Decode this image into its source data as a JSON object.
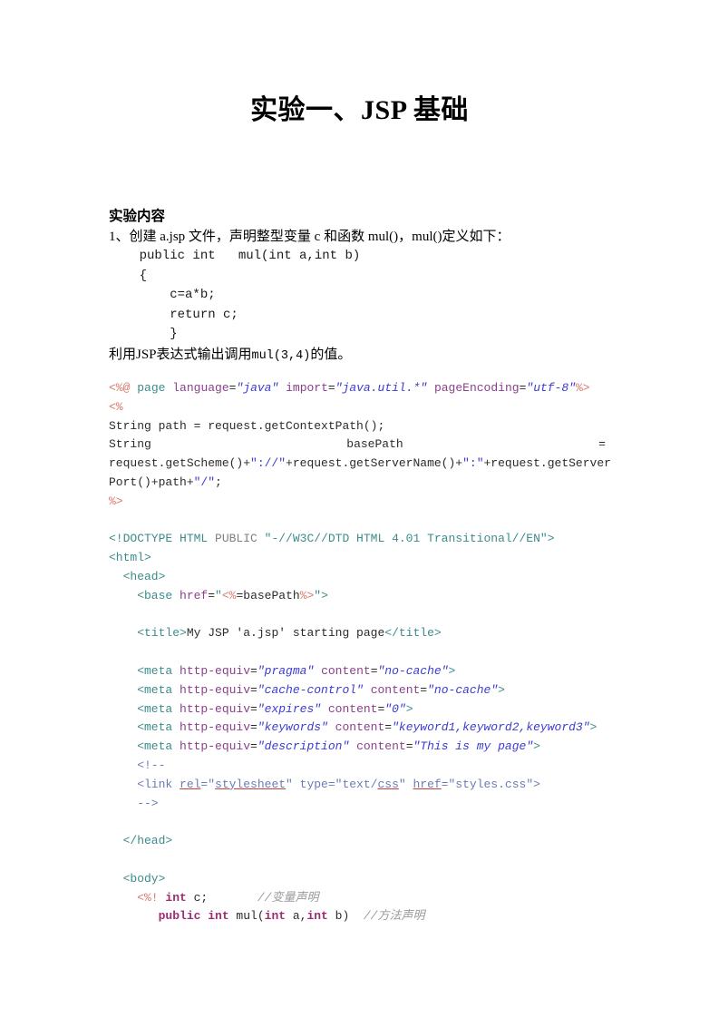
{
  "document": {
    "title": "实验一、JSP 基础",
    "section_heading": "实验内容",
    "task_line": "1、创建 a.jsp 文件，声明整型变量 c 和函数 mul()，mul()定义如下：",
    "task_code_lines": [
      "    public int   mul(int a,int b)",
      "    {",
      "        c=a*b;",
      "        return c;",
      "        }"
    ],
    "task_tail_prefix": "利用JSP表达式输出调用",
    "task_tail_mono": "mul(3,4)",
    "task_tail_suffix": "的值。"
  },
  "code_block": {
    "lines": [
      {
        "id": "page-directive",
        "parts": [
          {
            "text": "<%@ ",
            "style": "jsp"
          },
          {
            "text": "page ",
            "style": "tag"
          },
          {
            "text": "language",
            "style": "attr"
          },
          {
            "text": "=",
            "style": "plain"
          },
          {
            "text": "\"java\"",
            "style": "val"
          },
          {
            "text": " ",
            "style": "plain"
          },
          {
            "text": "import",
            "style": "attr"
          },
          {
            "text": "=",
            "style": "plain"
          },
          {
            "text": "\"java.util.*\"",
            "style": "val"
          },
          {
            "text": " ",
            "style": "plain"
          },
          {
            "text": "pageEncoding",
            "style": "attr"
          },
          {
            "text": "=",
            "style": "plain"
          },
          {
            "text": "\"utf-8\"",
            "style": "val"
          },
          {
            "text": "%>",
            "style": "jsp"
          }
        ]
      },
      {
        "id": "scriptlet-open",
        "parts": [
          {
            "text": "<%",
            "style": "jsp"
          }
        ]
      },
      {
        "id": "path-decl",
        "parts": [
          {
            "text": "String path = request.getContextPath();",
            "style": "plain"
          }
        ]
      },
      {
        "id": "basepath-decl",
        "justify": true,
        "parts": [
          {
            "text": "String",
            "style": "plain"
          },
          {
            "text": "basePath",
            "style": "plain"
          },
          {
            "text": "=",
            "style": "plain"
          }
        ]
      },
      {
        "id": "basepath-cont-1",
        "parts": [
          {
            "text": "request.getScheme()+",
            "style": "plain"
          },
          {
            "text": "\"://\"",
            "style": "str"
          },
          {
            "text": "+request.getServerName()+",
            "style": "plain"
          },
          {
            "text": "\":\"",
            "style": "str"
          },
          {
            "text": "+request.getServer",
            "style": "plain"
          }
        ]
      },
      {
        "id": "basepath-cont-2",
        "parts": [
          {
            "text": "Port()+path+",
            "style": "plain"
          },
          {
            "text": "\"/\"",
            "style": "str"
          },
          {
            "text": ";",
            "style": "plain"
          }
        ]
      },
      {
        "id": "scriptlet-close",
        "parts": [
          {
            "text": "%>",
            "style": "jsp"
          }
        ]
      },
      {
        "id": "gap-1",
        "blank": true
      },
      {
        "id": "doctype",
        "parts": [
          {
            "text": "<!DOCTYPE HTML ",
            "style": "tag"
          },
          {
            "text": "PUBLIC ",
            "style": "gray"
          },
          {
            "text": "\"-//W3C//DTD HTML 4.01 Transitional//EN\">",
            "style": "dtd"
          }
        ]
      },
      {
        "id": "html-open",
        "parts": [
          {
            "text": "<html>",
            "style": "tag"
          }
        ]
      },
      {
        "id": "head-open",
        "parts": [
          {
            "text": "  <head>",
            "style": "tag"
          }
        ]
      },
      {
        "id": "base-tag",
        "parts": [
          {
            "text": "    <base ",
            "style": "tag"
          },
          {
            "text": "href",
            "style": "attr"
          },
          {
            "text": "=",
            "style": "plain"
          },
          {
            "text": "\"",
            "style": "tag"
          },
          {
            "text": "<%",
            "style": "jsp"
          },
          {
            "text": "=basePath",
            "style": "plain"
          },
          {
            "text": "%>",
            "style": "jsp"
          },
          {
            "text": "\">",
            "style": "tag"
          }
        ]
      },
      {
        "id": "gap-2",
        "blank": true
      },
      {
        "id": "title-tag",
        "parts": [
          {
            "text": "    <title>",
            "style": "tag"
          },
          {
            "text": "My JSP 'a.jsp' starting page",
            "style": "plain"
          },
          {
            "text": "</title>",
            "style": "tag"
          }
        ]
      },
      {
        "id": "gap-3",
        "blank": true
      },
      {
        "id": "meta-pragma",
        "parts": [
          {
            "text": "    <meta ",
            "style": "tag"
          },
          {
            "text": "http-equiv",
            "style": "attr"
          },
          {
            "text": "=",
            "style": "plain"
          },
          {
            "text": "\"pragma\"",
            "style": "val"
          },
          {
            "text": " ",
            "style": "plain"
          },
          {
            "text": "content",
            "style": "attr"
          },
          {
            "text": "=",
            "style": "plain"
          },
          {
            "text": "\"no-cache\"",
            "style": "val"
          },
          {
            "text": ">",
            "style": "tag"
          }
        ]
      },
      {
        "id": "meta-cache-control",
        "parts": [
          {
            "text": "    <meta ",
            "style": "tag"
          },
          {
            "text": "http-equiv",
            "style": "attr"
          },
          {
            "text": "=",
            "style": "plain"
          },
          {
            "text": "\"cache-control\"",
            "style": "val"
          },
          {
            "text": " ",
            "style": "plain"
          },
          {
            "text": "content",
            "style": "attr"
          },
          {
            "text": "=",
            "style": "plain"
          },
          {
            "text": "\"no-cache\"",
            "style": "val"
          },
          {
            "text": ">",
            "style": "tag"
          }
        ]
      },
      {
        "id": "meta-expires",
        "parts": [
          {
            "text": "    <meta ",
            "style": "tag"
          },
          {
            "text": "http-equiv",
            "style": "attr"
          },
          {
            "text": "=",
            "style": "plain"
          },
          {
            "text": "\"expires\"",
            "style": "val"
          },
          {
            "text": " ",
            "style": "plain"
          },
          {
            "text": "content",
            "style": "attr"
          },
          {
            "text": "=",
            "style": "plain"
          },
          {
            "text": "\"0\"",
            "style": "val"
          },
          {
            "text": ">",
            "style": "tag"
          }
        ]
      },
      {
        "id": "meta-keywords",
        "parts": [
          {
            "text": "    <meta ",
            "style": "tag"
          },
          {
            "text": "http-equiv",
            "style": "attr"
          },
          {
            "text": "=",
            "style": "plain"
          },
          {
            "text": "\"keywords\"",
            "style": "val"
          },
          {
            "text": " ",
            "style": "plain"
          },
          {
            "text": "content",
            "style": "attr"
          },
          {
            "text": "=",
            "style": "plain"
          },
          {
            "text": "\"keyword1,keyword2,keyword3\"",
            "style": "val"
          },
          {
            "text": ">",
            "style": "tag"
          }
        ]
      },
      {
        "id": "meta-description",
        "parts": [
          {
            "text": "    <meta ",
            "style": "tag"
          },
          {
            "text": "http-equiv",
            "style": "attr"
          },
          {
            "text": "=",
            "style": "plain"
          },
          {
            "text": "\"description\"",
            "style": "val"
          },
          {
            "text": " ",
            "style": "plain"
          },
          {
            "text": "content",
            "style": "attr"
          },
          {
            "text": "=",
            "style": "plain"
          },
          {
            "text": "\"This is my page\"",
            "style": "val"
          },
          {
            "text": ">",
            "style": "tag"
          }
        ]
      },
      {
        "id": "comment-open",
        "parts": [
          {
            "text": "    <!--",
            "style": "htmlcm"
          }
        ]
      },
      {
        "id": "link-stylesheet",
        "parts": [
          {
            "text": "    <link ",
            "style": "htmlcm"
          },
          {
            "text": "rel",
            "style": "spell"
          },
          {
            "text": "=\"",
            "style": "htmlcm"
          },
          {
            "text": "stylesheet",
            "style": "spell"
          },
          {
            "text": "\" type=\"text/",
            "style": "htmlcm"
          },
          {
            "text": "css",
            "style": "spell"
          },
          {
            "text": "\" ",
            "style": "htmlcm"
          },
          {
            "text": "href",
            "style": "spell"
          },
          {
            "text": "=\"styles.css\">",
            "style": "htmlcm"
          }
        ]
      },
      {
        "id": "comment-close",
        "parts": [
          {
            "text": "    -->",
            "style": "htmlcm"
          }
        ]
      },
      {
        "id": "gap-4",
        "blank": true
      },
      {
        "id": "head-close",
        "parts": [
          {
            "text": "  </head>",
            "style": "tag"
          }
        ]
      },
      {
        "id": "gap-5",
        "blank": true
      },
      {
        "id": "body-open",
        "parts": [
          {
            "text": "  <body>",
            "style": "tag"
          }
        ]
      },
      {
        "id": "decl-var",
        "parts": [
          {
            "text": "    <%! ",
            "style": "jsp"
          },
          {
            "text": "int",
            "style": "kw"
          },
          {
            "text": " c;",
            "style": "plain"
          },
          {
            "text": "       ",
            "style": "plain"
          },
          {
            "text": "//变量声明",
            "style": "cmt"
          }
        ]
      },
      {
        "id": "decl-method",
        "parts": [
          {
            "text": "       ",
            "style": "plain"
          },
          {
            "text": "public int",
            "style": "kw"
          },
          {
            "text": " mul(",
            "style": "plain"
          },
          {
            "text": "int",
            "style": "kw"
          },
          {
            "text": " a,",
            "style": "plain"
          },
          {
            "text": "int",
            "style": "kw"
          },
          {
            "text": " b)  ",
            "style": "plain"
          },
          {
            "text": "//方法声明",
            "style": "cmt"
          }
        ]
      }
    ]
  },
  "colors": {
    "jsp_delimiter": "#d9796b",
    "tag": "#3d8b8b",
    "attribute": "#8b3f8b",
    "value": "#3b3bd4",
    "keyword": "#9b2d72",
    "comment": "#9a9a9a",
    "html_comment": "#6c7bb5",
    "spellcheck_underline": "#c04040",
    "page_background": "#ffffff",
    "text": "#000000"
  }
}
